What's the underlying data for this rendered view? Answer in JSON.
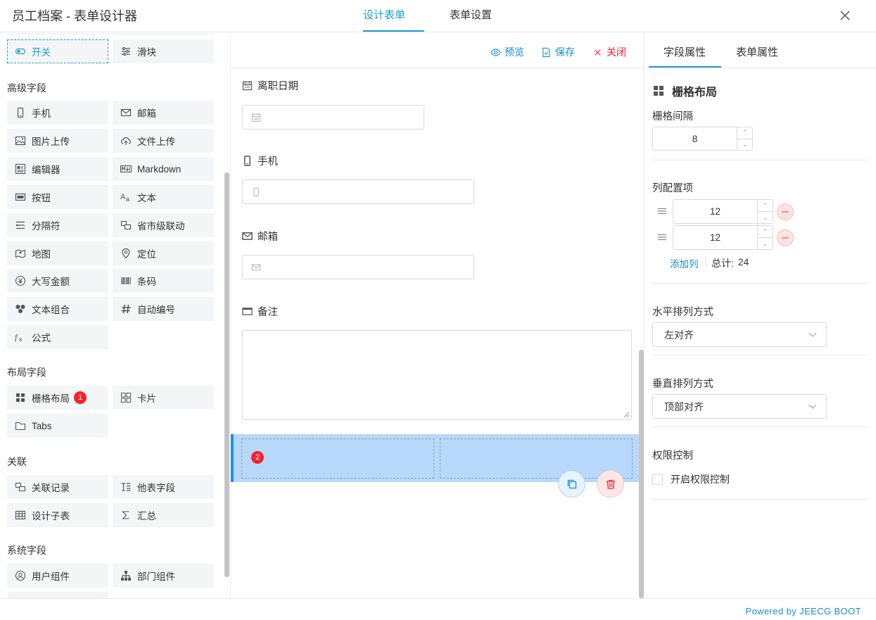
{
  "header": {
    "title": "员工档案 - 表单设计器",
    "tabs": [
      {
        "label": "设计表单"
      },
      {
        "label": "表单设置"
      }
    ],
    "active_tab": "设计表单",
    "accent_color": "#1a9cd3"
  },
  "palette": {
    "top_items": [
      {
        "label": "开关",
        "icon": "toggle-icon",
        "selected": true
      },
      {
        "label": "滑块",
        "icon": "slider-icon"
      }
    ],
    "sections": [
      {
        "title": "高级字段",
        "items": [
          {
            "label": "手机",
            "icon": "phone-icon"
          },
          {
            "label": "邮箱",
            "icon": "mail-icon"
          },
          {
            "label": "图片上传",
            "icon": "image-icon"
          },
          {
            "label": "文件上传",
            "icon": "cloud-upload-icon"
          },
          {
            "label": "编辑器",
            "icon": "editor-icon"
          },
          {
            "label": "Markdown",
            "icon": "markdown-icon"
          },
          {
            "label": "按钮",
            "icon": "button-icon"
          },
          {
            "label": "文本",
            "icon": "font-size-icon"
          },
          {
            "label": "分隔符",
            "icon": "divider-icon"
          },
          {
            "label": "省市级联动",
            "icon": "cascade-icon"
          },
          {
            "label": "地图",
            "icon": "map-icon"
          },
          {
            "label": "定位",
            "icon": "location-pin-icon"
          },
          {
            "label": "大写金额",
            "icon": "yen-icon"
          },
          {
            "label": "条码",
            "icon": "barcode-icon"
          },
          {
            "label": "文本组合",
            "icon": "cluster-icon"
          },
          {
            "label": "自动编号",
            "icon": "hash-icon"
          },
          {
            "label": "公式",
            "icon": "formula-icon"
          }
        ]
      },
      {
        "title": "布局字段",
        "items": [
          {
            "label": "栅格布局",
            "icon": "grid-icon",
            "badge": "1"
          },
          {
            "label": "卡片",
            "icon": "card-icon"
          },
          {
            "label": "Tabs",
            "icon": "tabs-icon"
          }
        ]
      },
      {
        "title": "关联",
        "items": [
          {
            "label": "关联记录",
            "icon": "link-record-icon"
          },
          {
            "label": "他表字段",
            "icon": "other-table-field-icon"
          },
          {
            "label": "设计子表",
            "icon": "table-icon"
          },
          {
            "label": "汇总",
            "icon": "sigma-icon"
          }
        ]
      },
      {
        "title": "系统字段",
        "items": [
          {
            "label": "用户组件",
            "icon": "user-circle-icon"
          },
          {
            "label": "部门组件",
            "icon": "org-chart-icon"
          }
        ]
      }
    ]
  },
  "canvas": {
    "toolbar": {
      "preview": "预览",
      "save": "保存",
      "close": "关闭"
    },
    "fields": [
      {
        "label": "离职日期",
        "icon": "calendar-icon",
        "input_icon": "calendar-icon"
      },
      {
        "label": "手机",
        "icon": "phone-icon",
        "input_icon": "phone-icon"
      },
      {
        "label": "邮箱",
        "icon": "mail-icon",
        "input_icon": "mail-icon"
      },
      {
        "label": "备注",
        "icon": "textarea-icon"
      }
    ],
    "grid_block": {
      "badge": "2",
      "columns": 2
    }
  },
  "props": {
    "tabs": [
      {
        "label": "字段属性"
      },
      {
        "label": "表单属性"
      }
    ],
    "active_tab": "字段属性",
    "component_title": "栅格布局",
    "gutter_label": "栅格间隔",
    "gutter_value": "8",
    "columns_label": "列配置项",
    "columns": [
      {
        "value": "12"
      },
      {
        "value": "12"
      }
    ],
    "add_column": "添加列",
    "total_label": "总计:",
    "total_value": "24",
    "justify_label": "水平排列方式",
    "justify_value": "左对齐",
    "align_label": "垂直排列方式",
    "align_value": "顶部对齐",
    "permission_label": "权限控制",
    "permission_checkbox": "开启权限控制",
    "permission_checked": false
  },
  "footer": {
    "powered": "Powered by JEECG BOOT"
  }
}
